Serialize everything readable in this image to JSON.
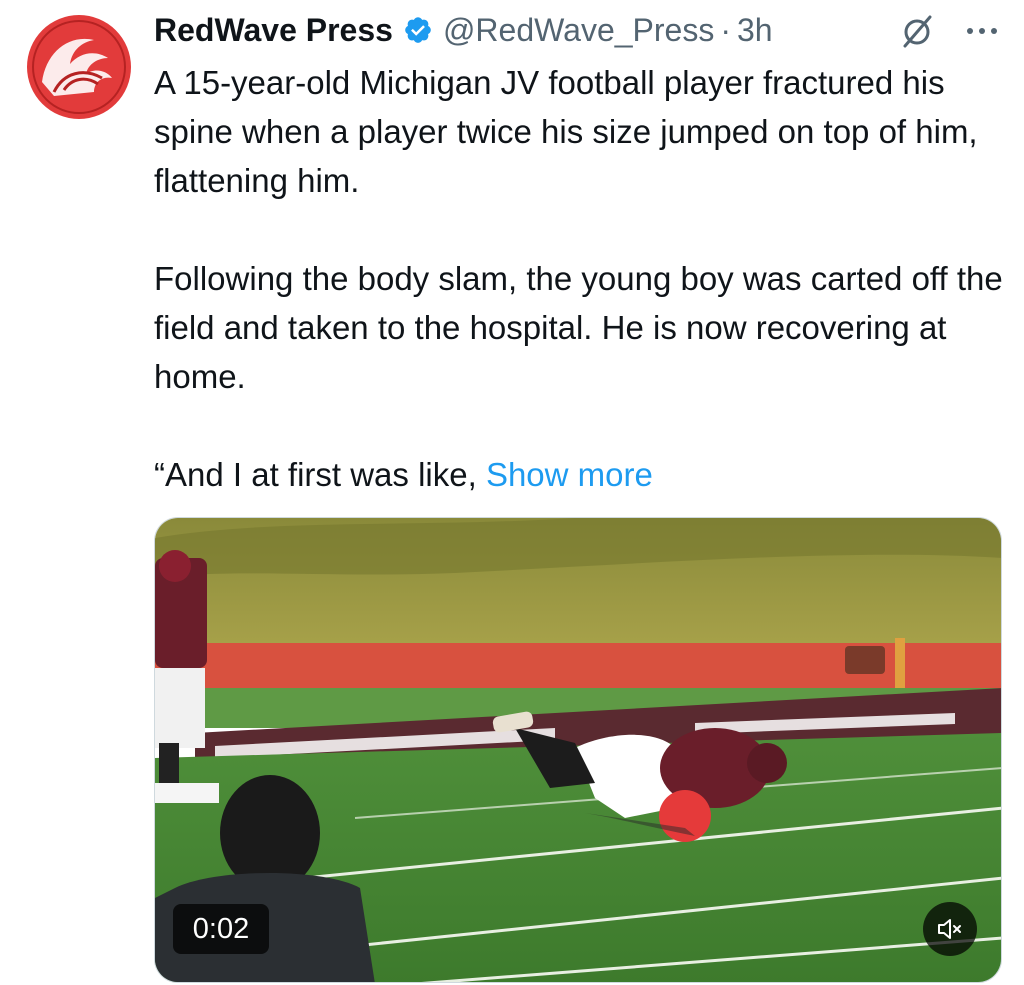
{
  "author": {
    "name": "RedWave Press",
    "handle": "@RedWave_Press",
    "separator": "·",
    "time": "3h"
  },
  "tweet": {
    "paragraph1": "A 15-year-old Michigan JV football player fractured his spine when a player twice his size jumped on top of him, flattening him.",
    "paragraph2": "Following the body slam, the young boy was carted off the field and taken to the hospital. He is now recovering at home.",
    "paragraph3": "“And I at first was like,",
    "show_more": "Show more"
  },
  "media": {
    "timestamp": "0:02"
  },
  "icons": {
    "verified": "verified-badge-icon",
    "grok": "grok-icon",
    "more": "more-options-icon",
    "mute": "muted-speaker-icon"
  },
  "colors": {
    "verified": "#1d9bf0",
    "link": "#1d9bf0",
    "secondary_text": "#536471",
    "avatar": "#e23b3b"
  }
}
